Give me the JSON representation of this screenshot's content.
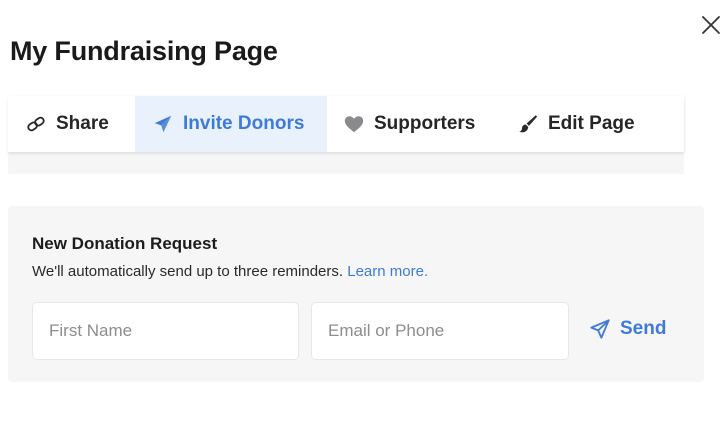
{
  "page": {
    "title": "My Fundraising Page"
  },
  "icons": {
    "close": "close-icon",
    "share": "link-icon",
    "invite": "paper-plane-icon",
    "supporters": "heart-icon",
    "edit": "paint-brush-icon",
    "send": "paper-plane-icon"
  },
  "colors": {
    "accent": "#3e7bd8",
    "active_tab_background": "#e9f1fd",
    "panel_background": "#f6f6f7"
  },
  "tabs": [
    {
      "label": "Share",
      "active": false
    },
    {
      "label": "Invite Donors",
      "active": true
    },
    {
      "label": "Supporters",
      "active": false
    },
    {
      "label": "Edit Page",
      "active": false
    }
  ],
  "request": {
    "title": "New Donation Request",
    "description": "We'll automatically send up to three reminders.",
    "learn_more": "Learn more.",
    "first_name_placeholder": "First Name",
    "contact_placeholder": "Email or Phone",
    "first_name_value": "",
    "contact_value": "",
    "send_label": "Send"
  }
}
